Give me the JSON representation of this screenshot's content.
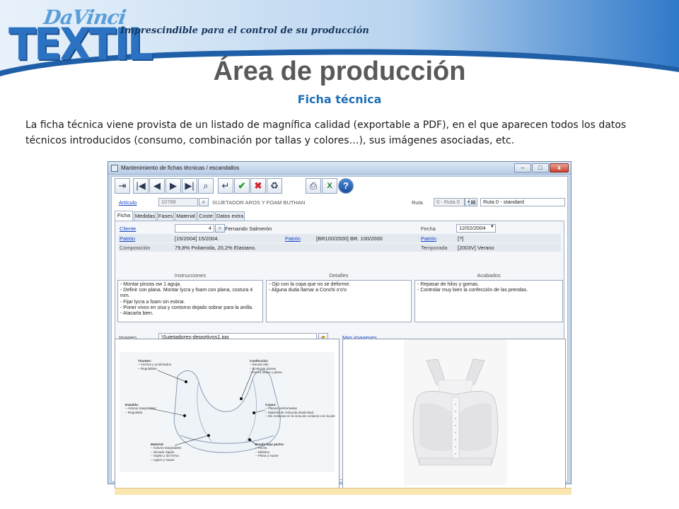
{
  "header": {
    "logo_top": "DaVinci",
    "logo_main": "TEXTIL",
    "tagline": "Imprescindible para el control de su producción",
    "title": "Área de producción",
    "subtitle": "Ficha técnica",
    "description": "La ficha técnica viene provista de un listado de magnífica calidad (exportable a PDF), en el que aparecen todos los datos técnicos introducidos (consumo, combinación por tallas y colores…), sus imágenes asociadas, etc."
  },
  "colors": {
    "accent": "#1f6fb5",
    "logo_blue": "#2b73c2",
    "window_frame": "#c9d9ec",
    "status_bar": "#fbe6b0"
  },
  "window": {
    "title": "Mantenimiento de fichas técnicas / escandallos",
    "minimize_glyph": "–",
    "maximize_glyph": "□",
    "close_glyph": "x"
  },
  "toolbar": {
    "icons": [
      "exit-icon",
      "first-record-icon",
      "previous-record-icon",
      "next-record-icon",
      "last-record-icon",
      "search-icon",
      "return-icon",
      "accept-icon",
      "cancel-icon",
      "delete-icon",
      "print-icon",
      "excel-icon",
      "help-icon"
    ],
    "glyphs": [
      "⇥",
      "|◀",
      "◀",
      "▶",
      "▶|",
      "⌕",
      "↵",
      "✔",
      "✖",
      "♻",
      "⎙",
      "X",
      "?"
    ]
  },
  "articulo": {
    "label": "Artículo",
    "code": "10788",
    "description": "SUJETADOR AROS Y FOAM BUTHAN",
    "ruta_label": "Ruta",
    "ruta_value": "0 - Ruta 0",
    "ruta_name": "Ruta 0 - standard"
  },
  "tabs": [
    "Ficha",
    "Medidas",
    "Fases",
    "Material",
    "Coste",
    "Datos extra"
  ],
  "ficha": {
    "cliente_label": "Cliente",
    "cliente_code": "4",
    "cliente_name": "Fernando Salmerón",
    "fecha_label": "Fecha",
    "fecha_value": "12/02/2004",
    "patron_label": "Patrón",
    "patron_value": "[15/2004] 15/2004.",
    "patron2_label": "Patrón",
    "patron2_value": "[BR100/2000] BR. 100/2000",
    "patron3_label": "Patrón",
    "patron3_value": "[?]",
    "composicion_label": "Composición",
    "composicion_value": "79,8% Poliamida, 20,2% Elastano.",
    "temporada_label": "Temporada",
    "temporada_value": "[2003V] Verano"
  },
  "sections": {
    "instrucciones": {
      "title": "Instrucciones",
      "lines": [
        "- Montar pinzas ow 1 aguja.",
        "- Definir con plana. Montar lycra y foam con plana, costura 4 mm.",
        "- Fijar lycra a foam sin estirar.",
        "- Poner vivos en sisa y contorno dejado sobrar para la anilla.",
        "- Atacarla bien."
      ]
    },
    "detalles": {
      "title": "Detalles",
      "lines": [
        "- Ojo con la copa que no se deforme.",
        "- Alguna duda llamar a Conchi o'o'o"
      ]
    },
    "acabados": {
      "title": "Acabados",
      "lines": [
        "- Repasar de hilos y gomas.",
        "- Controlar muy bien la confección de las prendas."
      ]
    }
  },
  "imagen": {
    "label": "Imagen",
    "path": "\\Sujetadores-deportivos1.jpg",
    "more_link": "Mas imagenes"
  },
  "diagram": {
    "callouts": [
      {
        "title": "Tirantes:",
        "lines": [
          "– Anchos y acolchados",
          "– Regulables"
        ]
      },
      {
        "title": "Confección:",
        "lines": [
          "– Escote alto",
          "– Costuras planas",
          "– Cierre suave y plano"
        ]
      },
      {
        "title": "Espalda:",
        "lines": [
          "– Activos traspirables",
          "– Regulable"
        ]
      },
      {
        "title": "Copas:",
        "lines": [
          "– Planas preformadas",
          "– Material de reducida elasticidad",
          "– Sin costuras en la zona de contacto con la piel"
        ]
      },
      {
        "title": "Material:",
        "lines": [
          "– Activos traspirables",
          "– Secado rápido",
          "– Sujeto y da forma",
          "– Ligero y suave"
        ]
      },
      {
        "title": "Banda bajo pecho:",
        "lines": [
          "– Ancha",
          "– Elástica",
          "– Plana y suave"
        ]
      }
    ]
  }
}
